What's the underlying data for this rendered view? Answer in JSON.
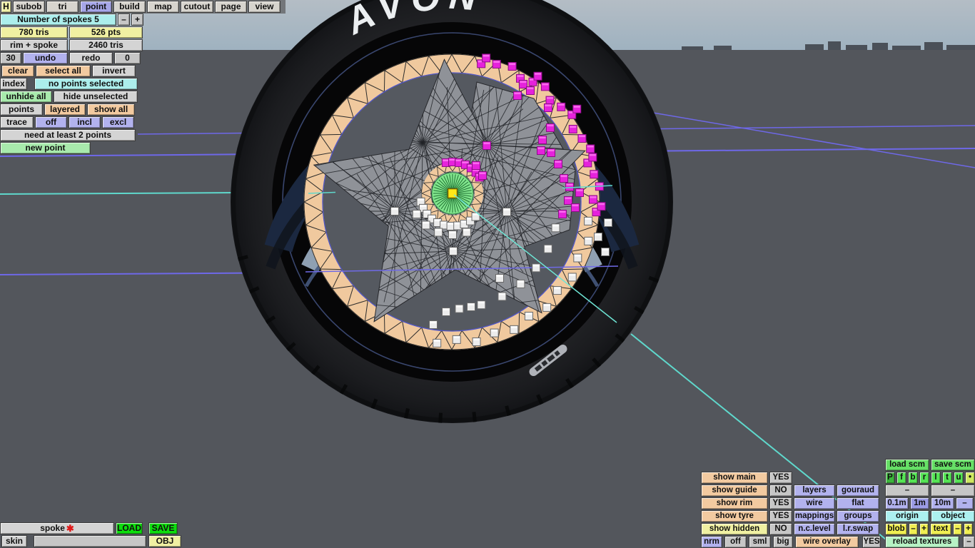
{
  "palette": {
    "peach": "#f2caa0",
    "lavender": "#b2b2ee",
    "cyan": "#aceeec",
    "yellow": "#f0f0a2",
    "bright_yellow": "#f0ee52",
    "green": "#a8eaac",
    "bright_green": "#0ddd0d",
    "scm_green": "#66e066",
    "gray": "#d4d4d4",
    "magenta_point": "#e622dc",
    "white_point": "#ececec",
    "guide_purple": "#6e68e8",
    "guide_cyan": "#5fd8cc",
    "rim_peach": "#f0c99e",
    "mesh_gray": "#8f9298",
    "hub_green": "#82e68e",
    "select_yellow": "#ffe818"
  },
  "menu": {
    "items": [
      "H",
      "subob",
      "tri",
      "point",
      "build",
      "map",
      "cutout",
      "page",
      "view"
    ],
    "active_item": "point"
  },
  "left_panel": {
    "spokes_label": "Number of spokes 5",
    "spokes_minus": "–",
    "spokes_plus": "+",
    "tris_count": "780 tris",
    "pts_count": "526 pts",
    "rim_spoke_label": "rim + spoke",
    "rim_spoke_tris": "2460 tris",
    "undo_steps": "30",
    "undo_label": "undo",
    "redo_label": "redo",
    "redo_steps": "0",
    "clear_label": "clear",
    "select_all_label": "select all",
    "invert_label": "invert",
    "index_label": "index",
    "selection_status": "no points selected",
    "unhide_all_label": "unhide all",
    "hide_unselected_label": "hide unselected",
    "points_label": "points",
    "layered_label": "layered",
    "show_all_label": "show all",
    "trace_label": "trace",
    "trace_off": "off",
    "trace_incl": "incl",
    "trace_excl": "excl",
    "hint": "need at least 2 points",
    "new_point_label": "new point"
  },
  "viewport": {
    "tire_brand": "AVON"
  },
  "file_bar": {
    "name": "spoke",
    "modified_marker": "✱",
    "load": "LOAD",
    "save": "SAVE",
    "skin": "skin",
    "obj": "OBJ"
  },
  "display_panel": {
    "toggles": [
      {
        "label": "show main",
        "value": "YES"
      },
      {
        "label": "show guide",
        "value": "NO"
      },
      {
        "label": "show rim",
        "value": "YES"
      },
      {
        "label": "show tyre",
        "value": "YES"
      },
      {
        "label": "show hidden",
        "value": "NO"
      }
    ],
    "modes": {
      "layers": "layers",
      "gouraud": "gouraud",
      "wire": "wire",
      "flat": "flat",
      "mappings": "mappings",
      "groups": "groups",
      "nclevel": "n.c.level",
      "lrswap": "l.r.swap"
    },
    "norm_row": {
      "nrm": "nrm",
      "off": "off",
      "sml": "sml",
      "big": "big",
      "wire_overlay": "wire overlay",
      "wire_overlay_value": "YES"
    }
  },
  "scm_panel": {
    "load_scm": "load scm",
    "save_scm": "save scm",
    "channel_buttons": [
      "P",
      "f",
      "b",
      "r",
      "l",
      "t",
      "u",
      "•"
    ],
    "dash1": "–",
    "dash2": "–",
    "scale_buttons": [
      "0.1m",
      "1m",
      "10m",
      "–"
    ],
    "origin": "origin",
    "object": "object",
    "blob": "blob",
    "blob_minus": "–",
    "blob_plus": "+",
    "text": "text",
    "text_minus": "–",
    "text_plus": "+",
    "reload_textures": "reload textures",
    "reload_minus": "–"
  }
}
